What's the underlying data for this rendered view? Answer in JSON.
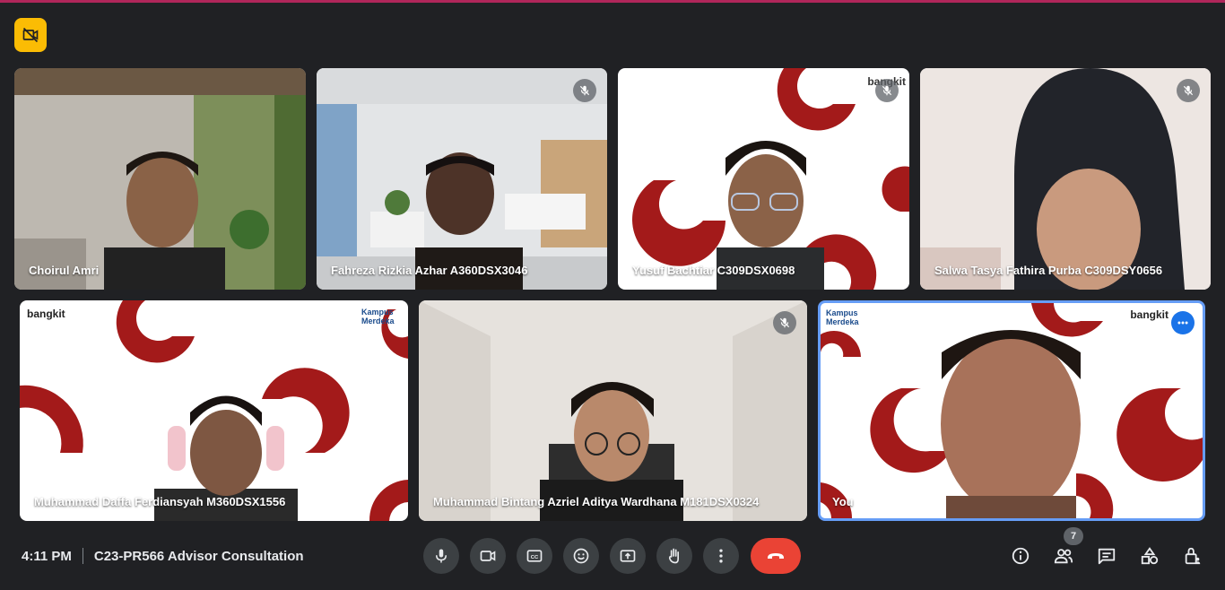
{
  "meeting": {
    "time": "4:11 PM",
    "title": "C23-PR566 Advisor Consultation"
  },
  "participants": [
    {
      "name": "Choirul Amri",
      "muted": false
    },
    {
      "name": "Fahreza Rizkia Azhar A360DSX3046",
      "muted": true
    },
    {
      "name": "Yusuf Bachtiar C309DSX0698",
      "muted": true
    },
    {
      "name": "Salwa Tasya Fathira Purba C309DSY0656",
      "muted": true
    },
    {
      "name": "Muhammad Daffa Ferdiansyah M360DSX1556",
      "muted": false
    },
    {
      "name": "Muhammad Bintang Azriel Aditya Wardhana M181DSX0324",
      "muted": true
    },
    {
      "name": "You",
      "muted": false
    }
  ],
  "logos": {
    "bangkit": "bangkit",
    "kampus_merdeka": "Kampus Merdeka",
    "bangkit_mirrored": "bangkit",
    "kampus_merdeka_mirrored": "Kampus Merdeka"
  },
  "controls": {
    "people_count": "7"
  },
  "icons": {
    "hide_video": "video-off-icon",
    "mic": "mic-icon",
    "camera": "camera-icon",
    "captions": "captions-icon",
    "reactions": "emoji-icon",
    "present": "present-screen-icon",
    "raise_hand": "hand-icon",
    "more_options": "more-vertical-icon",
    "end_call": "end-call-icon",
    "info": "info-icon",
    "people": "people-icon",
    "chat": "chat-icon",
    "activities": "activities-icon",
    "host_controls": "lock-person-icon"
  },
  "colors": {
    "background": "#202124",
    "accent_line": "#b0265a",
    "warning": "#fbbc04",
    "end_call": "#ea4335",
    "self_border": "#669df6",
    "bangkit_red": "#a31a1a"
  }
}
